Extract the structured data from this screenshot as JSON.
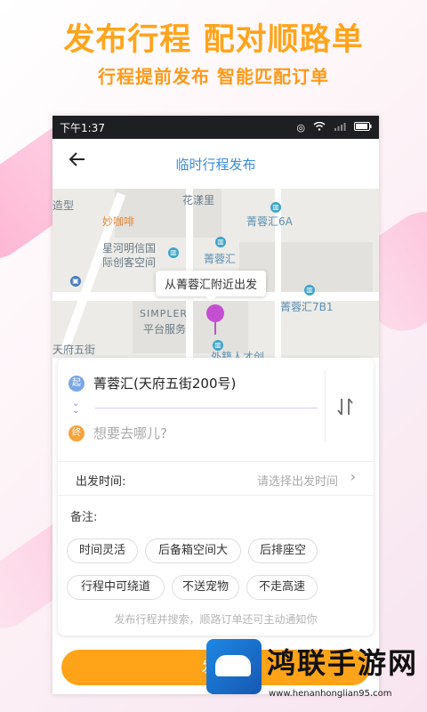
{
  "promo": {
    "headline": "发布行程 配对顺路单",
    "subline": "行程提前发布 智能匹配订单"
  },
  "status_bar": {
    "time": "下午1:37"
  },
  "nav": {
    "title": "临时行程发布",
    "back_icon": "back-arrow-icon"
  },
  "map": {
    "labels": {
      "huayangli": "花漾里",
      "jingronghui6a": "菁蓉汇6A",
      "coffee": "妙咖啡",
      "xinghe": "星河明信国",
      "chuangke": "际创客空间",
      "jingronghui": "菁蓉汇",
      "jingronghui7b1": "菁蓉汇7B1",
      "simpler": "SIMPLER",
      "platform": "平台服务",
      "zao": "造型",
      "waiji": "外籍人才创",
      "tianfu": "天府五街"
    },
    "bubble": "从菁蓉汇附近出发",
    "pin_color": "#c44fd1"
  },
  "trip": {
    "from_tag": "起",
    "from": "菁蓉汇(天府五街200号)",
    "to_tag": "终",
    "to_placeholder": "想要去哪儿?",
    "swap_icon": "swap-vertical-icon"
  },
  "departure": {
    "label": "出发时间:",
    "hint": "请选择出发时间",
    "arrow": "›"
  },
  "remarks": {
    "label": "备注:",
    "tags": [
      "时间灵活",
      "后备箱空间大",
      "后排座空",
      "行程中可绕道",
      "不送宠物",
      "不走高速"
    ]
  },
  "footnote": "发布行程并搜索，顺路订单还可主动通知你",
  "publish_button": "发布",
  "watermark": {
    "title": "鸿联手游网",
    "url": "www.henanhonglian95.com"
  },
  "colors": {
    "accent": "#ffa318",
    "nav_title": "#3a8bd6"
  }
}
